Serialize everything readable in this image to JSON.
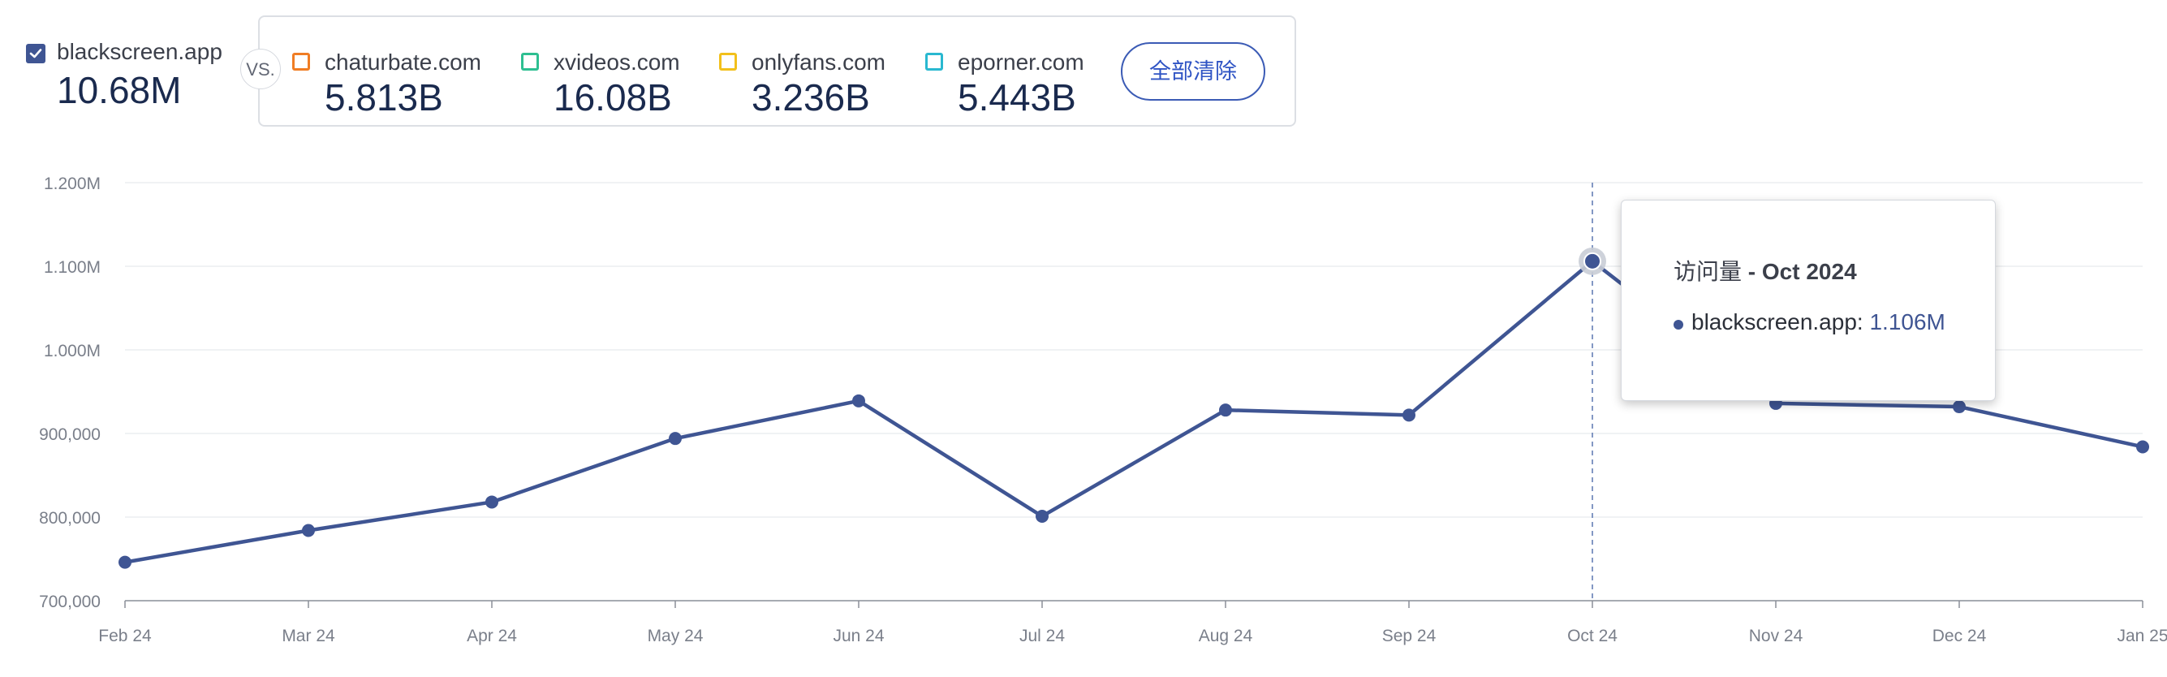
{
  "primary_site": {
    "name": "blackscreen.app",
    "total": "10.68M",
    "checked": true,
    "color": "#3f5593"
  },
  "vs_label": "VS.",
  "comparisons": [
    {
      "name": "chaturbate.com",
      "total": "5.813B",
      "color": "#f07d24"
    },
    {
      "name": "xvideos.com",
      "total": "16.08B",
      "color": "#2ebf91"
    },
    {
      "name": "onlyfans.com",
      "total": "3.236B",
      "color": "#f2c01b"
    },
    {
      "name": "eporner.com",
      "total": "5.443B",
      "color": "#29b8d0"
    }
  ],
  "clear_all_label": "全部清除",
  "tooltip": {
    "metric": "访问量",
    "separator": " - ",
    "period": "Oct 2024",
    "series_name": "blackscreen.app",
    "series_value": "1.106M"
  },
  "chart_data": {
    "type": "line",
    "categories": [
      "Feb 24",
      "Mar 24",
      "Apr 24",
      "May 24",
      "Jun 24",
      "Jul 24",
      "Aug 24",
      "Sep 24",
      "Oct 24",
      "Nov 24",
      "Dec 24",
      "Jan 25"
    ],
    "series": [
      {
        "name": "blackscreen.app",
        "color": "#3f5593",
        "values": [
          746000,
          784000,
          818000,
          894000,
          939000,
          801000,
          928000,
          922000,
          1106000,
          936000,
          932000,
          884000
        ]
      }
    ],
    "y_ticks": [
      700000,
      800000,
      900000,
      1000000,
      1100000,
      1200000
    ],
    "y_tick_labels": [
      "700,000",
      "800,000",
      "900,000",
      "1.000M",
      "1.100M",
      "1.200M"
    ],
    "ylim": [
      700000,
      1200000
    ],
    "grid": true,
    "highlight_index": 8
  }
}
